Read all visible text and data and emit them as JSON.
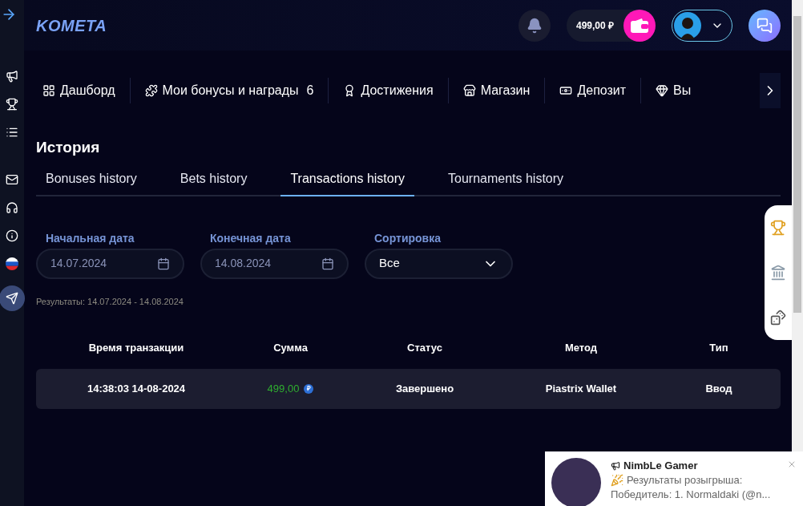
{
  "logo": "KOMETA",
  "header": {
    "balance": "499,00 ₽"
  },
  "nav": [
    {
      "label": "Дашборд"
    },
    {
      "label": "Мои бонусы и награды",
      "badge": "6"
    },
    {
      "label": "Достижения"
    },
    {
      "label": "Магазин"
    },
    {
      "label": "Депозит"
    },
    {
      "label": "Вы"
    }
  ],
  "title": "История",
  "tabs": [
    {
      "label": "Bonuses history",
      "selected": false
    },
    {
      "label": "Bets history",
      "selected": false
    },
    {
      "label": "Transactions history",
      "selected": true
    },
    {
      "label": "Tournaments history",
      "selected": false
    }
  ],
  "filters": [
    {
      "kind": "date",
      "label": "Начальная дата",
      "value": "14.07.2024"
    },
    {
      "kind": "date",
      "label": "Конечная дата",
      "value": "14.08.2024"
    },
    {
      "kind": "select",
      "label": "Сортировка",
      "value": "Все"
    }
  ],
  "results": "Результаты: 14.07.2024 - 14.08.2024",
  "table": {
    "columns": [
      "Время транзакции",
      "Сумма",
      "Статус",
      "Метод",
      "Тип"
    ],
    "rows": [
      {
        "time": "14:38:03 14-08-2024",
        "amount": "499,00",
        "currency": "₽",
        "status": "Завершено",
        "method": "Piastrix Wallet",
        "type": "Ввод"
      }
    ]
  },
  "notification": {
    "sender": "NimbLe Gamer",
    "lines": [
      "Результаты розыгрыша:",
      "Победитель: 1. Normaldaki (@n..."
    ]
  }
}
